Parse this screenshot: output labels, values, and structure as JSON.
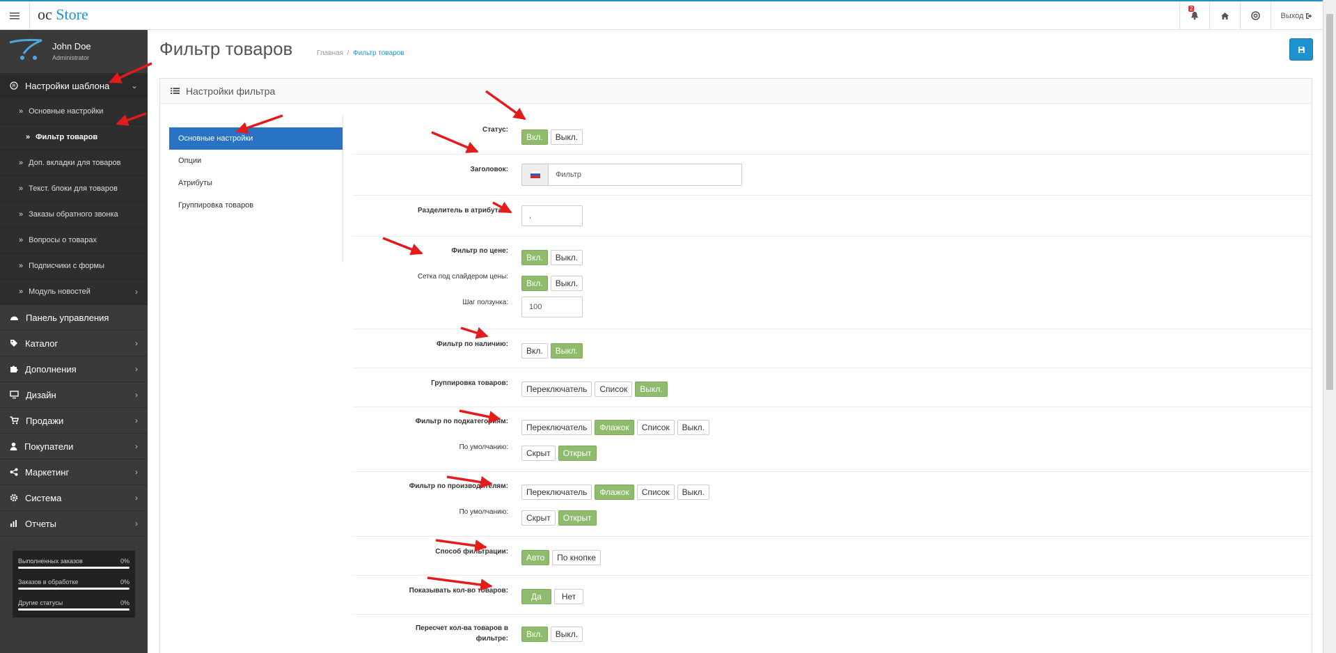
{
  "header": {
    "logo_oc": "oc",
    "logo_store": "Store",
    "notification_count": "2",
    "logout_label": "Выход"
  },
  "sidebar": {
    "user_name": "John Doe",
    "user_role": "Administrator",
    "template_section": "Настройки шаблона",
    "submenu": [
      "Основные настройки",
      "Фильтр товаров",
      "Доп. вкладки для товаров",
      "Текст. блоки для товаров",
      "Заказы обратного звонка",
      "Вопросы о товарах",
      "Подписчики с формы",
      "Модуль новостей"
    ],
    "sections": [
      "Панель управления",
      "Каталог",
      "Дополнения",
      "Дизайн",
      "Продажи",
      "Покупатели",
      "Маркетинг",
      "Система",
      "Отчеты"
    ],
    "stats": [
      {
        "label": "Выполненных заказов",
        "value": "0%"
      },
      {
        "label": "Заказов в обработке",
        "value": "0%"
      },
      {
        "label": "Другие статусы",
        "value": "0%"
      }
    ]
  },
  "main": {
    "title": "Фильтр товаров",
    "breadcrumb_home": "Главная",
    "breadcrumb_sep": "/",
    "breadcrumb_current": "Фильтр товаров",
    "panel_title": "Настройки фильтра",
    "tabs": [
      "Основные настройки",
      "Опции",
      "Атрибуты",
      "Группировка товаров"
    ],
    "form": {
      "status_label": "Статус:",
      "on": "Вкл.",
      "off": "Выкл.",
      "heading_label": "Заголовок:",
      "heading_value": "Фильтр",
      "separator_label": "Разделитель в атрибутах:",
      "separator_value": ",",
      "price_filter_label": "Фильтр по цене:",
      "price_grid_label": "Сетка под слайдером цены:",
      "slider_step_label": "Шаг ползунка:",
      "slider_step_value": "100",
      "stock_filter_label": "Фильтр по наличию:",
      "grouping_label": "Группировка товаров:",
      "switcher": "Переключатель",
      "list": "Список",
      "checkbox": "Флажок",
      "subcat_label": "Фильтр по подкатегориям:",
      "default_label": "По умолчанию:",
      "hidden": "Скрыт",
      "open": "Открыт",
      "manufacturer_label": "Фильтр по производителям:",
      "method_label": "Способ фильтрации:",
      "auto": "Авто",
      "by_button": "По кнопке",
      "show_count_label": "Показывать кол-во товаров:",
      "yes": "Да",
      "no": "Нет",
      "recount_label_1": "Пересчет кол-ва товаров в",
      "recount_label_2": "фильтре:"
    }
  },
  "colors": {
    "accent": "#1e91cf",
    "active_toggle": "#8fbb6c",
    "active_tab": "#2973c4",
    "sidebar_bg": "#3a3a3a",
    "annotation_arrow": "#e31b1b"
  }
}
